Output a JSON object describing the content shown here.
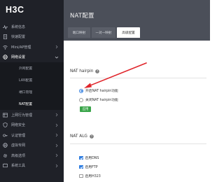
{
  "brand": {
    "logo_text": "H3C"
  },
  "sidebar": {
    "items": [
      {
        "label": "系统信息",
        "icon": "pulse-icon",
        "expandable": false,
        "active": false
      },
      {
        "label": "快速配置",
        "icon": "document-icon",
        "expandable": false,
        "active": false
      },
      {
        "label": "Mini/AP管理",
        "icon": "wifi-icon",
        "expandable": true,
        "active": false
      },
      {
        "label": "网络设置",
        "icon": "globe-icon",
        "expandable": true,
        "active": true
      }
    ],
    "sub_items": [
      {
        "label": "外网配置",
        "active": false
      },
      {
        "label": "LAN配置",
        "active": false
      },
      {
        "label": "端口管理",
        "active": false
      },
      {
        "label": "NAT配置",
        "active": true
      }
    ],
    "items_after": [
      {
        "label": "上网行为管理",
        "icon": "grid-icon",
        "expandable": true
      },
      {
        "label": "网络安全",
        "icon": "shield-icon",
        "expandable": true
      },
      {
        "label": "认证管理",
        "icon": "key-icon",
        "expandable": true
      },
      {
        "label": "虚拟专网",
        "icon": "globe-icon",
        "expandable": true
      },
      {
        "label": "高级选项",
        "icon": "gear-icon",
        "expandable": true
      },
      {
        "label": "系统工具",
        "icon": "tools-icon",
        "expandable": true
      }
    ]
  },
  "header": {
    "title": "NAT配置",
    "tabs": [
      {
        "label": "端口映射",
        "active": false
      },
      {
        "label": "一对一映射",
        "active": false
      },
      {
        "label": "高级配置",
        "active": true
      }
    ]
  },
  "nat_hairpin": {
    "title": "NAT hairpin",
    "options": [
      {
        "label": "开启NAT hairpin功能",
        "checked": true
      },
      {
        "label": "关闭NAT hairpin功能",
        "checked": false
      }
    ],
    "apply_label": "应用"
  },
  "nat_alg": {
    "title": "NAT ALG",
    "options": [
      {
        "label": "启用DNS",
        "checked": true
      },
      {
        "label": "启用FTP",
        "checked": true
      },
      {
        "label": "启用H323",
        "checked": false
      }
    ]
  },
  "colors": {
    "sidebar_bg": "#1f2128",
    "header_bg": "#4b4f59",
    "accent": "#2f7de0",
    "apply_button": "#3aa54a",
    "annotation_arrow": "#e0252b"
  }
}
